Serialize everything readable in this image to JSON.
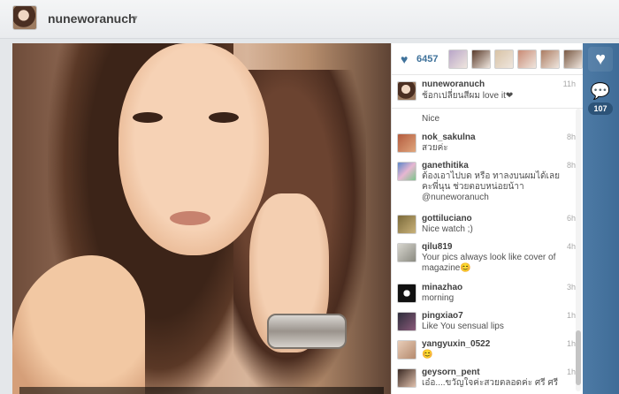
{
  "header": {
    "username": "nuneworanuch",
    "caret": "▾"
  },
  "likes": {
    "icon": "heart-icon",
    "count": "6457",
    "liker_colors": [
      "#b9a6c8",
      "#5a3b2b",
      "#d8c3a6",
      "#c98b75",
      "#ac7c62",
      "#7a5a45"
    ]
  },
  "caption": {
    "user": "nuneworanuch",
    "time": "11h",
    "text": "ช้อกเปลี่ยนสีผม love it❤"
  },
  "comments": [
    {
      "user": "",
      "time": "",
      "text": "Nice"
    },
    {
      "user": "nok_sakulna",
      "time": "8h",
      "text": "สวยค่ะ"
    },
    {
      "user": "ganethitika",
      "time": "8h",
      "text": "ต้องเอาไปบด หรือ ทาลงบนผมได้เลยคะพี่นุน ช่วยตอบหน่อยน้าา @nuneworanuch"
    },
    {
      "user": "gottiluciano",
      "time": "6h",
      "text": "Nice watch ;)"
    },
    {
      "user": "qilu819",
      "time": "4h",
      "text": "Your pics always look like cover of magazine😊"
    },
    {
      "user": "minazhao",
      "time": "3h",
      "text": "morning"
    },
    {
      "user": "pingxiao7",
      "time": "1h",
      "text": "Like You sensual lips"
    },
    {
      "user": "yangyuxin_0522",
      "time": "1h",
      "text": "😊"
    },
    {
      "user": "geysorn_pent",
      "time": "1h",
      "text": "เอ๋อ....ขวัญใจค่ะสวยตลอดค่ะ ศรี ศรี"
    }
  ],
  "actions": {
    "like_icon": "heart-icon",
    "comment_icon": "speech-bubble-icon",
    "comment_count": "107"
  }
}
